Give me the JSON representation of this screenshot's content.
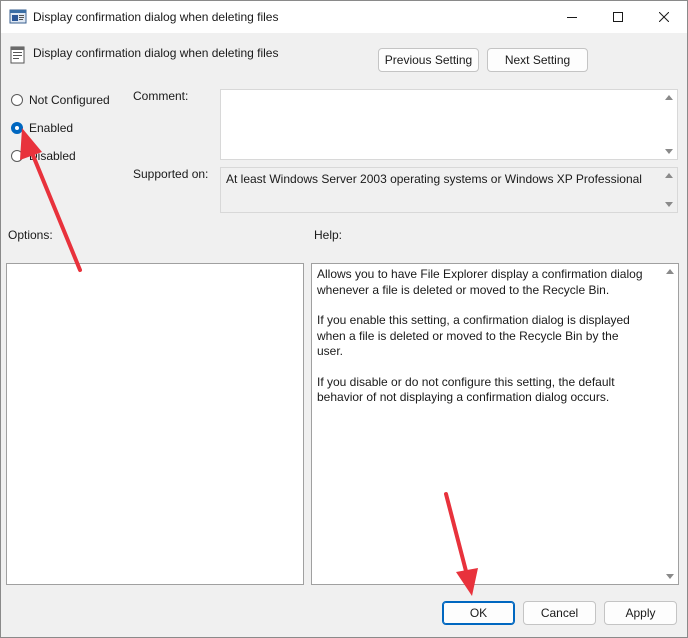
{
  "window": {
    "title": "Display confirmation dialog when deleting files"
  },
  "header": {
    "policy_name": "Display confirmation dialog when deleting files",
    "previous_setting_label": "Previous Setting",
    "next_setting_label": "Next Setting"
  },
  "state": {
    "options": [
      {
        "label": "Not Configured",
        "selected": false
      },
      {
        "label": "Enabled",
        "selected": true
      },
      {
        "label": "Disabled",
        "selected": false
      }
    ]
  },
  "comment": {
    "label": "Comment:",
    "value": ""
  },
  "supported": {
    "label": "Supported on:",
    "value": "At least Windows Server 2003 operating systems or Windows XP Professional"
  },
  "options_panel": {
    "label": "Options:"
  },
  "help_panel": {
    "label": "Help:",
    "paragraphs": [
      "Allows you to have File Explorer display a confirmation dialog whenever a file is deleted or moved to the Recycle Bin.",
      "If you enable this setting, a confirmation dialog is displayed when a file is deleted or moved to the Recycle Bin by the user.",
      "If you disable or do not configure this setting, the default behavior of not displaying a confirmation dialog occurs."
    ]
  },
  "footer": {
    "ok_label": "OK",
    "cancel_label": "Cancel",
    "apply_label": "Apply"
  },
  "colors": {
    "accent": "#0067c0",
    "annotation_arrow": "#e8323c"
  },
  "icons": {
    "title": "policy-window-icon",
    "header": "policy-setting-icon",
    "minimize": "minimize-icon",
    "maximize": "maximize-icon",
    "close": "close-icon"
  }
}
